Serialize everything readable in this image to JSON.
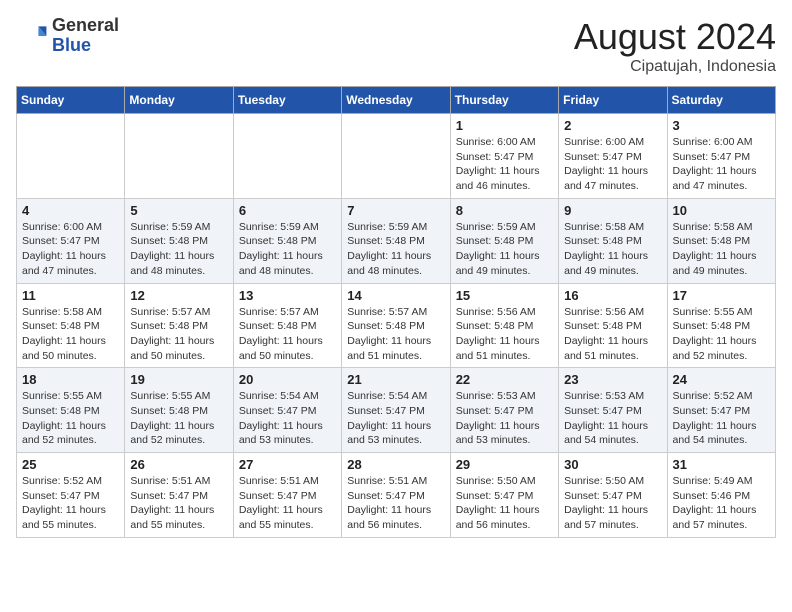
{
  "header": {
    "logo_general": "General",
    "logo_blue": "Blue",
    "month_year": "August 2024",
    "location": "Cipatujah, Indonesia"
  },
  "weekdays": [
    "Sunday",
    "Monday",
    "Tuesday",
    "Wednesday",
    "Thursday",
    "Friday",
    "Saturday"
  ],
  "weeks": [
    [
      {
        "day": "",
        "info": ""
      },
      {
        "day": "",
        "info": ""
      },
      {
        "day": "",
        "info": ""
      },
      {
        "day": "",
        "info": ""
      },
      {
        "day": "1",
        "info": "Sunrise: 6:00 AM\nSunset: 5:47 PM\nDaylight: 11 hours\nand 46 minutes."
      },
      {
        "day": "2",
        "info": "Sunrise: 6:00 AM\nSunset: 5:47 PM\nDaylight: 11 hours\nand 47 minutes."
      },
      {
        "day": "3",
        "info": "Sunrise: 6:00 AM\nSunset: 5:47 PM\nDaylight: 11 hours\nand 47 minutes."
      }
    ],
    [
      {
        "day": "4",
        "info": "Sunrise: 6:00 AM\nSunset: 5:47 PM\nDaylight: 11 hours\nand 47 minutes."
      },
      {
        "day": "5",
        "info": "Sunrise: 5:59 AM\nSunset: 5:48 PM\nDaylight: 11 hours\nand 48 minutes."
      },
      {
        "day": "6",
        "info": "Sunrise: 5:59 AM\nSunset: 5:48 PM\nDaylight: 11 hours\nand 48 minutes."
      },
      {
        "day": "7",
        "info": "Sunrise: 5:59 AM\nSunset: 5:48 PM\nDaylight: 11 hours\nand 48 minutes."
      },
      {
        "day": "8",
        "info": "Sunrise: 5:59 AM\nSunset: 5:48 PM\nDaylight: 11 hours\nand 49 minutes."
      },
      {
        "day": "9",
        "info": "Sunrise: 5:58 AM\nSunset: 5:48 PM\nDaylight: 11 hours\nand 49 minutes."
      },
      {
        "day": "10",
        "info": "Sunrise: 5:58 AM\nSunset: 5:48 PM\nDaylight: 11 hours\nand 49 minutes."
      }
    ],
    [
      {
        "day": "11",
        "info": "Sunrise: 5:58 AM\nSunset: 5:48 PM\nDaylight: 11 hours\nand 50 minutes."
      },
      {
        "day": "12",
        "info": "Sunrise: 5:57 AM\nSunset: 5:48 PM\nDaylight: 11 hours\nand 50 minutes."
      },
      {
        "day": "13",
        "info": "Sunrise: 5:57 AM\nSunset: 5:48 PM\nDaylight: 11 hours\nand 50 minutes."
      },
      {
        "day": "14",
        "info": "Sunrise: 5:57 AM\nSunset: 5:48 PM\nDaylight: 11 hours\nand 51 minutes."
      },
      {
        "day": "15",
        "info": "Sunrise: 5:56 AM\nSunset: 5:48 PM\nDaylight: 11 hours\nand 51 minutes."
      },
      {
        "day": "16",
        "info": "Sunrise: 5:56 AM\nSunset: 5:48 PM\nDaylight: 11 hours\nand 51 minutes."
      },
      {
        "day": "17",
        "info": "Sunrise: 5:55 AM\nSunset: 5:48 PM\nDaylight: 11 hours\nand 52 minutes."
      }
    ],
    [
      {
        "day": "18",
        "info": "Sunrise: 5:55 AM\nSunset: 5:48 PM\nDaylight: 11 hours\nand 52 minutes."
      },
      {
        "day": "19",
        "info": "Sunrise: 5:55 AM\nSunset: 5:48 PM\nDaylight: 11 hours\nand 52 minutes."
      },
      {
        "day": "20",
        "info": "Sunrise: 5:54 AM\nSunset: 5:47 PM\nDaylight: 11 hours\nand 53 minutes."
      },
      {
        "day": "21",
        "info": "Sunrise: 5:54 AM\nSunset: 5:47 PM\nDaylight: 11 hours\nand 53 minutes."
      },
      {
        "day": "22",
        "info": "Sunrise: 5:53 AM\nSunset: 5:47 PM\nDaylight: 11 hours\nand 53 minutes."
      },
      {
        "day": "23",
        "info": "Sunrise: 5:53 AM\nSunset: 5:47 PM\nDaylight: 11 hours\nand 54 minutes."
      },
      {
        "day": "24",
        "info": "Sunrise: 5:52 AM\nSunset: 5:47 PM\nDaylight: 11 hours\nand 54 minutes."
      }
    ],
    [
      {
        "day": "25",
        "info": "Sunrise: 5:52 AM\nSunset: 5:47 PM\nDaylight: 11 hours\nand 55 minutes."
      },
      {
        "day": "26",
        "info": "Sunrise: 5:51 AM\nSunset: 5:47 PM\nDaylight: 11 hours\nand 55 minutes."
      },
      {
        "day": "27",
        "info": "Sunrise: 5:51 AM\nSunset: 5:47 PM\nDaylight: 11 hours\nand 55 minutes."
      },
      {
        "day": "28",
        "info": "Sunrise: 5:51 AM\nSunset: 5:47 PM\nDaylight: 11 hours\nand 56 minutes."
      },
      {
        "day": "29",
        "info": "Sunrise: 5:50 AM\nSunset: 5:47 PM\nDaylight: 11 hours\nand 56 minutes."
      },
      {
        "day": "30",
        "info": "Sunrise: 5:50 AM\nSunset: 5:47 PM\nDaylight: 11 hours\nand 57 minutes."
      },
      {
        "day": "31",
        "info": "Sunrise: 5:49 AM\nSunset: 5:46 PM\nDaylight: 11 hours\nand 57 minutes."
      }
    ]
  ]
}
